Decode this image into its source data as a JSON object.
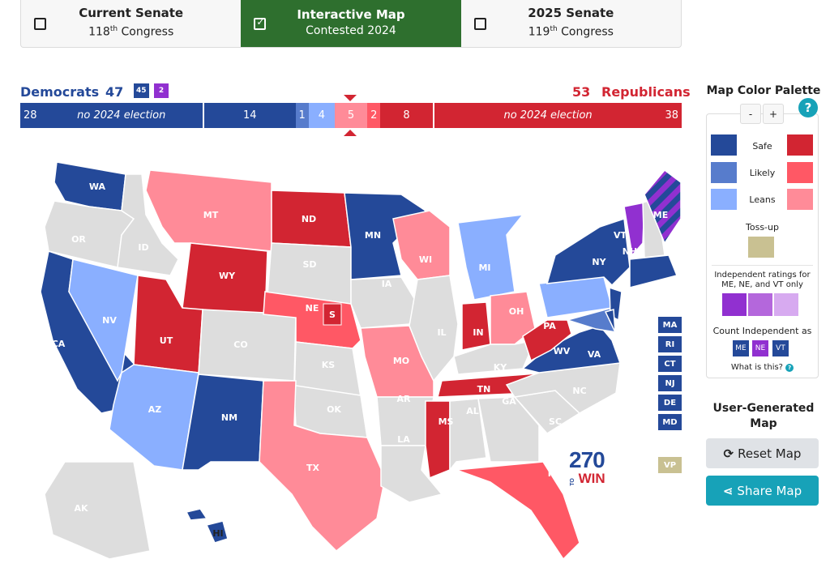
{
  "mode_tabs": [
    {
      "title": "Current Senate",
      "subtitle_num": "118",
      "subtitle_sup": "th",
      "subtitle_rest": " Congress",
      "checked": false
    },
    {
      "title": "Interactive Map",
      "subtitle_num": "Contested 2024",
      "subtitle_sup": "",
      "subtitle_rest": "",
      "checked": true
    },
    {
      "title": "2025 Senate",
      "subtitle_num": "119",
      "subtitle_sup": "th",
      "subtitle_rest": " Congress",
      "checked": false
    }
  ],
  "balance": {
    "dem_label": "Democrats",
    "dem_total": "47",
    "dem_badge": "45",
    "ind_badge": "2",
    "rep_total": "53",
    "rep_label": "Republicans",
    "segments": [
      {
        "key": "dem_no_election",
        "count": "28",
        "note": "no 2024 election",
        "color": "#244999"
      },
      {
        "key": "dem_safe",
        "count": "14",
        "color": "#244999"
      },
      {
        "key": "dem_likely",
        "count": "1",
        "color": "#577ccc"
      },
      {
        "key": "dem_leans",
        "count": "4",
        "color": "#8aafff"
      },
      {
        "key": "rep_leans",
        "count": "5",
        "color": "#ff8b98"
      },
      {
        "key": "rep_likely",
        "count": "2",
        "color": "#ff5865"
      },
      {
        "key": "rep_safe",
        "count": "8",
        "color": "#d22532"
      },
      {
        "key": "rep_no_election",
        "count": "38",
        "note": "no 2024 election",
        "color": "#d22532"
      }
    ]
  },
  "colors": {
    "safe_d": "#244999",
    "likely_d": "#577ccc",
    "leans_d": "#8aafff",
    "safe_r": "#d22532",
    "likely_r": "#ff5865",
    "leans_r": "#ff8b98",
    "tossup": "#c9c192",
    "none": "#dddddd",
    "ind_safe": "#9130d0",
    "ind_likely": "#b467dc",
    "ind_leans": "#d7aaf0"
  },
  "map": {
    "states": {
      "WA": "safe_d",
      "OR": "none",
      "CA": "safe_d",
      "NV": "leans_d",
      "ID": "none",
      "MT": "leans_r",
      "WY": "safe_r",
      "UT": "safe_r",
      "AZ": "leans_d",
      "CO": "none",
      "NM": "safe_d",
      "ND": "safe_r",
      "SD": "none",
      "NE": "likely_r",
      "KS": "none",
      "OK": "none",
      "TX": "leans_r",
      "MN": "safe_d",
      "IA": "none",
      "MO": "leans_r",
      "AR": "none",
      "LA": "none",
      "WI": "leans_r",
      "IL": "none",
      "MI": "leans_d",
      "IN": "safe_r",
      "OH": "leans_r",
      "KY": "none",
      "TN": "safe_r",
      "MS": "safe_r",
      "AL": "none",
      "GA": "none",
      "FL": "likely_r",
      "SC": "none",
      "NC": "none",
      "VA": "safe_d",
      "WV": "safe_r",
      "PA": "leans_d",
      "NY": "safe_d",
      "VT": "ind_safe",
      "NH": "none",
      "ME": "ind_safe",
      "MD": "likely_d",
      "AK": "none",
      "HI": "safe_d",
      "NE_S": "safe_r"
    },
    "small_state_buttons": [
      "MA",
      "RI",
      "CT",
      "NJ",
      "DE",
      "MD"
    ],
    "vp_button": "VP",
    "special_label": "S",
    "logo_number": "270",
    "logo_to": "TO",
    "logo_win": "WIN"
  },
  "palette": {
    "title": "Map Color Palette",
    "zoom_out": "-",
    "zoom_in": "+",
    "help": "?",
    "rows": [
      "Safe",
      "Likely",
      "Leans"
    ],
    "tossup_label": "Toss-up",
    "independent_note": "Independent ratings for ME, NE, and VT only",
    "count_as_label": "Count Independent as",
    "count_as_states": [
      {
        "code": "ME",
        "as": "safe_d"
      },
      {
        "code": "NE",
        "as": "ind_safe"
      },
      {
        "code": "VT",
        "as": "safe_d"
      }
    ],
    "what_is_this": "What is this?"
  },
  "user_map": {
    "title": "User-Generated Map",
    "reset_label": "Reset Map",
    "share_label": "Share Map"
  }
}
